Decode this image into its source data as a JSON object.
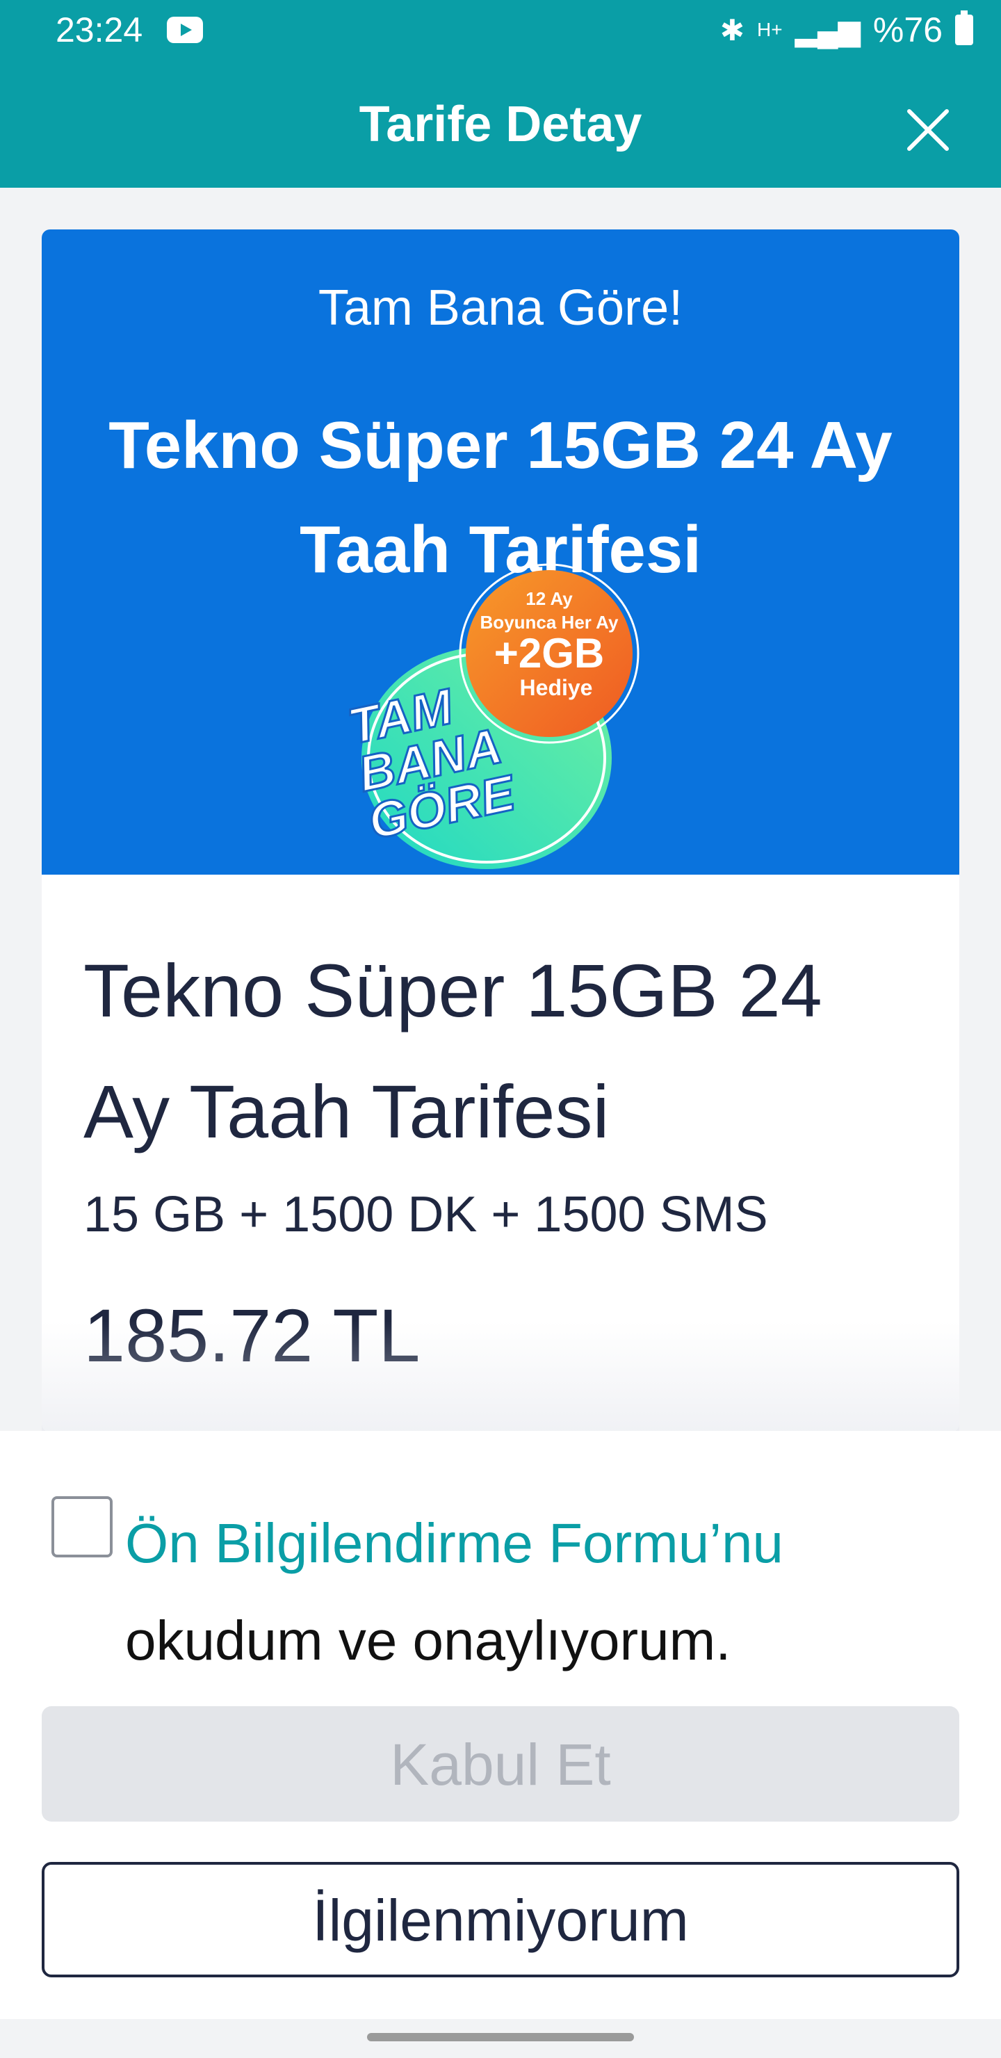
{
  "status_bar": {
    "time": "23:24",
    "network_label": "H+",
    "battery": "%76",
    "icons": [
      "youtube-icon",
      "bluetooth-icon",
      "network-icon",
      "signal-icon",
      "battery-icon"
    ]
  },
  "header": {
    "title": "Tarife Detay",
    "close_icon": "close-icon"
  },
  "banner": {
    "subtitle": "Tam Bana Göre!",
    "title": "Tekno Süper 15GB 24 Ay Taah Tarifesi",
    "badge": {
      "top_line": "12 Ay",
      "mid_line": "Boyunca Her Ay",
      "amount": "+2GB",
      "gift": "Hediye",
      "logo_lines": [
        "TAM",
        "BANA",
        "GÖRE"
      ]
    },
    "colors": {
      "background": "#0a73dd",
      "orange": "#f26b21",
      "teal": "#1fd8c4"
    }
  },
  "plan": {
    "name": "Tekno Süper 15GB 24 Ay Taah Tarifesi",
    "features": "15 GB + 1500 DK + 1500 SMS",
    "price": "185.72 TL"
  },
  "consent": {
    "link_text": "Ön Bilgilendirme Formu’nu",
    "rest_text": "okudum ve onaylıyorum.",
    "checked": false
  },
  "actions": {
    "accept": "Kabul Et",
    "decline": "İlgilenmiyorum"
  },
  "colors": {
    "teal": "#0a9ea6",
    "navy": "#1f2740",
    "disabled_bg": "#e3e5e9",
    "disabled_text": "#b1b5bd"
  }
}
